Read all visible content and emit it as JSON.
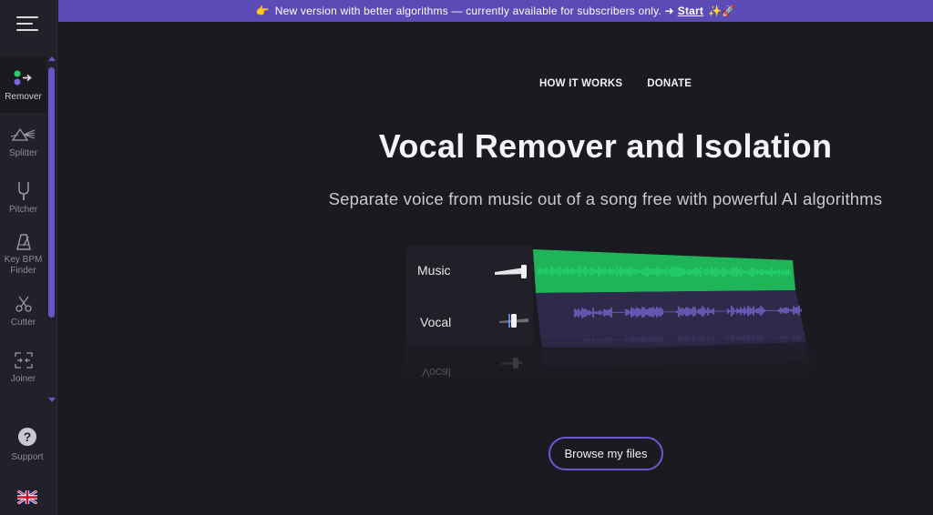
{
  "banner": {
    "pre_icon": "👉",
    "text": "New version with better algorithms — currently available for subscribers only. ➜",
    "link": "Start",
    "post_icon": "✨🚀"
  },
  "sidebar": {
    "items": [
      {
        "label": "Remover",
        "icon": "remover-icon",
        "active": true
      },
      {
        "label": "Splitter",
        "icon": "splitter-prism-icon",
        "active": false
      },
      {
        "label": "Pitcher",
        "icon": "tuning-fork-icon",
        "active": false
      },
      {
        "label": "Key BPM Finder",
        "icon": "metronome-icon",
        "active": false
      },
      {
        "label": "Cutter",
        "icon": "scissors-icon",
        "active": false
      },
      {
        "label": "Joiner",
        "icon": "joiner-icon",
        "active": false
      }
    ],
    "support": {
      "label": "Support",
      "icon": "question-icon"
    },
    "language_flag": "uk-flag-icon"
  },
  "nav": {
    "how_it_works": "HOW IT WORKS",
    "donate": "DONATE"
  },
  "hero": {
    "title": "Vocal Remover and Isolation",
    "subtitle": "Separate voice from music out of a song free with powerful AI algorithms"
  },
  "illustration": {
    "tracks": [
      {
        "name": "Music",
        "color": "#23d46b"
      },
      {
        "name": "Vocal",
        "color": "#7b68d8"
      }
    ],
    "reflection_text": "Vocal"
  },
  "actions": {
    "browse_label": "Browse my files"
  },
  "colors": {
    "accent": "#5b4bb4",
    "music_wave": "#23d46b",
    "vocal_wave": "#7b68d8",
    "background": "#1a1a20"
  }
}
